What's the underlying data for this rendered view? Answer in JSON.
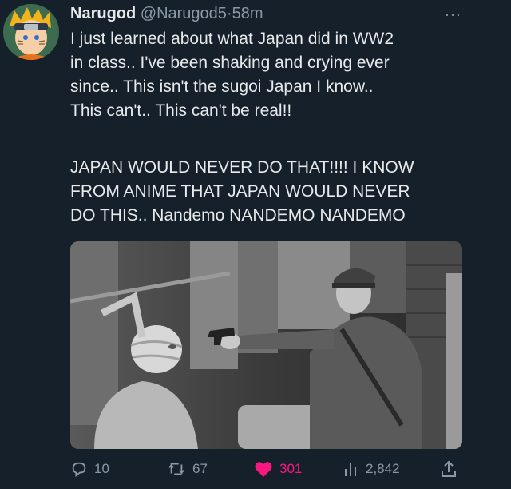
{
  "tweet": {
    "author_name": "Narugod",
    "author_handle": "@Narugod5",
    "separator": "·",
    "time": "58m",
    "more_label": "···",
    "paragraph1": "I just learned about what Japan did in WW2\nin class.. I've been shaking and crying ever\nsince.. This isn't the sugoi Japan I know..\nThis can't.. This can't be real!!",
    "paragraph2": "JAPAN WOULD NEVER DO THAT!!!! I KNOW\nFROM ANIME THAT JAPAN WOULD NEVER\nDO THIS.. Nandemo NANDEMO NANDEMO"
  },
  "actions": {
    "replies": "10",
    "retweets": "67",
    "likes": "301",
    "views": "2,842"
  },
  "colors": {
    "background": "#15202b",
    "text": "#e7e9ea",
    "muted": "#8b98a5",
    "like": "#f91880"
  },
  "icons": [
    "reply-icon",
    "retweet-icon",
    "heart-icon",
    "views-icon",
    "share-icon"
  ]
}
